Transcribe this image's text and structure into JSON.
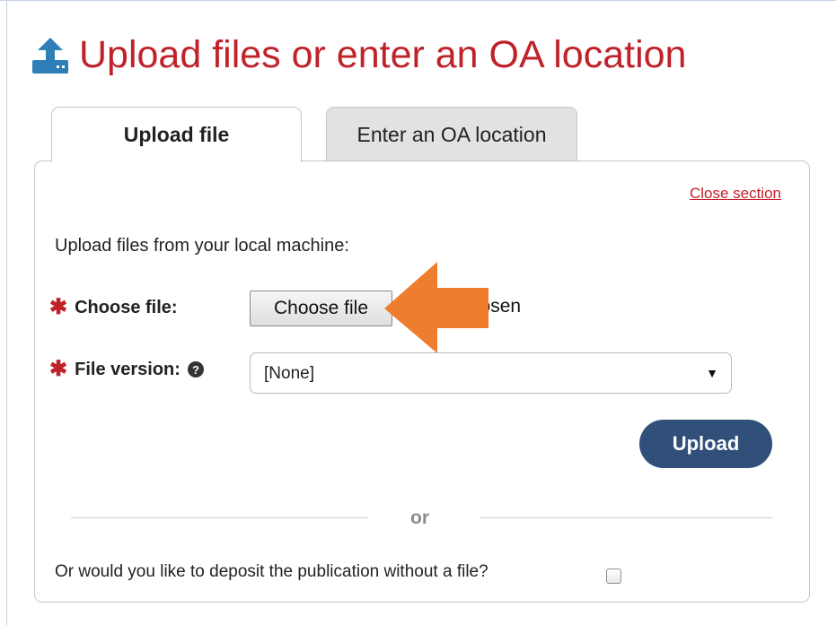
{
  "header": {
    "title": "Upload files or enter an OA location",
    "icon": "upload-icon",
    "title_color": "#c0222a"
  },
  "tabs": [
    {
      "label": "Upload file",
      "active": true
    },
    {
      "label": "Enter an OA location",
      "active": false
    }
  ],
  "panel": {
    "close_label": "Close section",
    "intro": "Upload files from your local machine:",
    "choose_file": {
      "label": "Choose file:",
      "button_label": "Choose file",
      "status": "No file chosen"
    },
    "file_version": {
      "label": "File version:",
      "selected": "[None]",
      "help_icon": "question-circle-icon"
    },
    "upload_label": "Upload",
    "upload_color": "#30507a",
    "or_label": "or",
    "deposit_label": "Or would you like to deposit the publication without a file?",
    "deposit_checked": false
  },
  "annotation": {
    "icon": "orange-arrow-icon",
    "color": "#ee7d2e"
  }
}
